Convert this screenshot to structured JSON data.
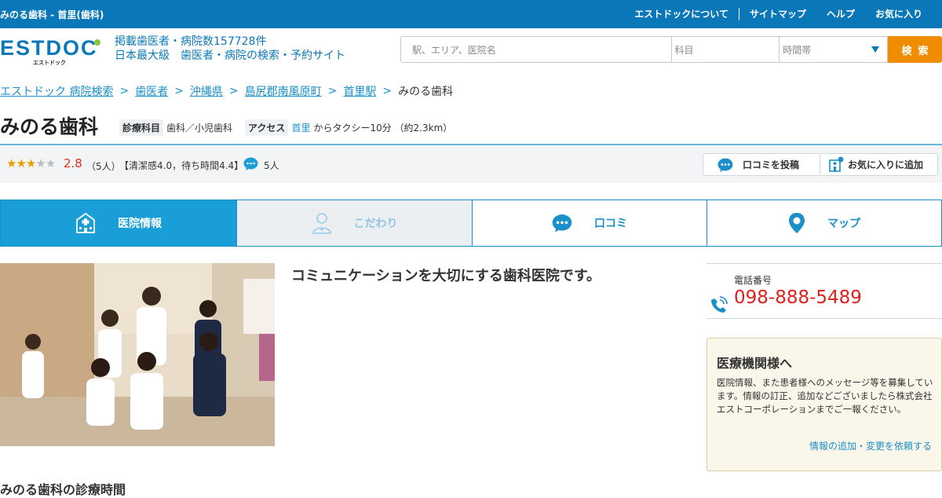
{
  "topbar": {
    "title": "みのる歯科 - 首里(歯科)",
    "nav": [
      "エストドックについて",
      "サイトマップ",
      "ヘルプ",
      "お気に入り"
    ]
  },
  "header": {
    "logo_text": "ESTDOC",
    "logo_sub": "エストドック",
    "tagline_line1": "掲載歯医者・病院数157728件",
    "tagline_line2": "日本最大級　歯医者・病院の検索・予約サイト"
  },
  "search": {
    "keyword_placeholder": "駅、エリア、医院名",
    "subject_placeholder": "科目",
    "time_placeholder": "時間帯",
    "button_label": "検索"
  },
  "breadcrumb": [
    "エストドック 病院検索",
    "歯医者",
    "沖縄県",
    "島尻郡南風原町",
    "首里駅",
    "みのる歯科"
  ],
  "clinic": {
    "name": "みのる歯科",
    "dept_label": "診療科目",
    "dept_value": "歯科／小児歯科",
    "access_label": "アクセス",
    "access_station": "首里",
    "access_detail": "からタクシー10分 （約2.3km）"
  },
  "rating": {
    "stars_filled": 3,
    "stars_total": 5,
    "score": "2.8",
    "count": "（5人）",
    "detail": "【清潔感4.0，待ち時間4.4】",
    "reviewers": "5人",
    "post_review_label": "口コミを投稿",
    "favorite_label": "お気に入りに追加"
  },
  "tabs": [
    {
      "label": "医院情報",
      "active": true
    },
    {
      "label": "こだわり",
      "active": false
    },
    {
      "label": "口コミ",
      "active": false
    },
    {
      "label": "マップ",
      "active": false
    }
  ],
  "main": {
    "headline": "コミュニケーションを大切にする歯科医院です。",
    "hours_title": "みのる歯科の診療時間"
  },
  "phone": {
    "label": "電話番号",
    "number": "098-888-5489"
  },
  "notice": {
    "title": "医療機関様へ",
    "body": "医院情報、また患者様へのメッセージ等を募集しています。情報の訂正、追加などございましたら株式会社エストコーポレーションまでご一報ください。",
    "link": "情報の追加・変更を依頼する"
  },
  "colors": {
    "brand_blue": "#0a78b8",
    "tab_active": "#1a9ed8",
    "search_button": "#f08c00",
    "phone_red": "#e0201e",
    "star": "#e8a000"
  }
}
